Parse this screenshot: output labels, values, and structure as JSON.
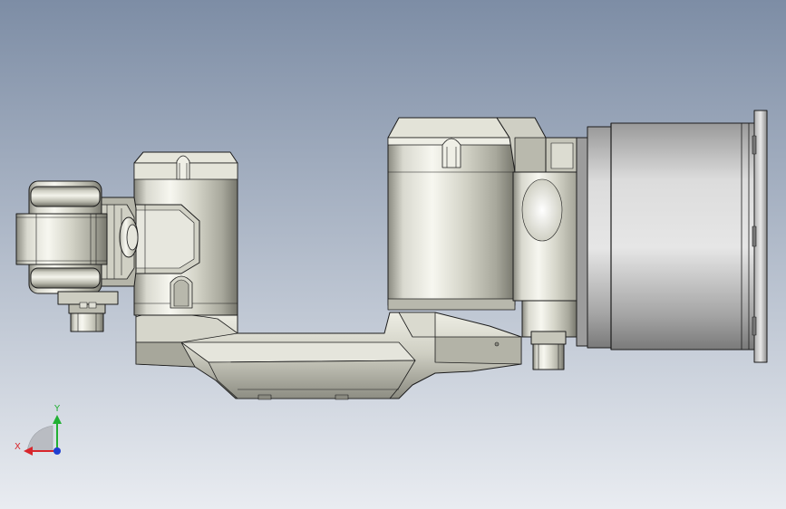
{
  "viewport": {
    "background_top": "#7d8da5",
    "background_bottom": "#e9ecf1"
  },
  "model": {
    "metal_light": "#f6f6ef",
    "metal_mid": "#c9c9bd",
    "metal_dark": "#6d6d64",
    "edge_color": "#1c1c1c",
    "motor_light": "#e4e4e4",
    "motor_dark": "#7a7a7a"
  },
  "triad": {
    "x_label": "X",
    "y_label": "Y",
    "x_color": "#d8262c",
    "y_color": "#21b033",
    "z_color": "#1f3fd1"
  }
}
